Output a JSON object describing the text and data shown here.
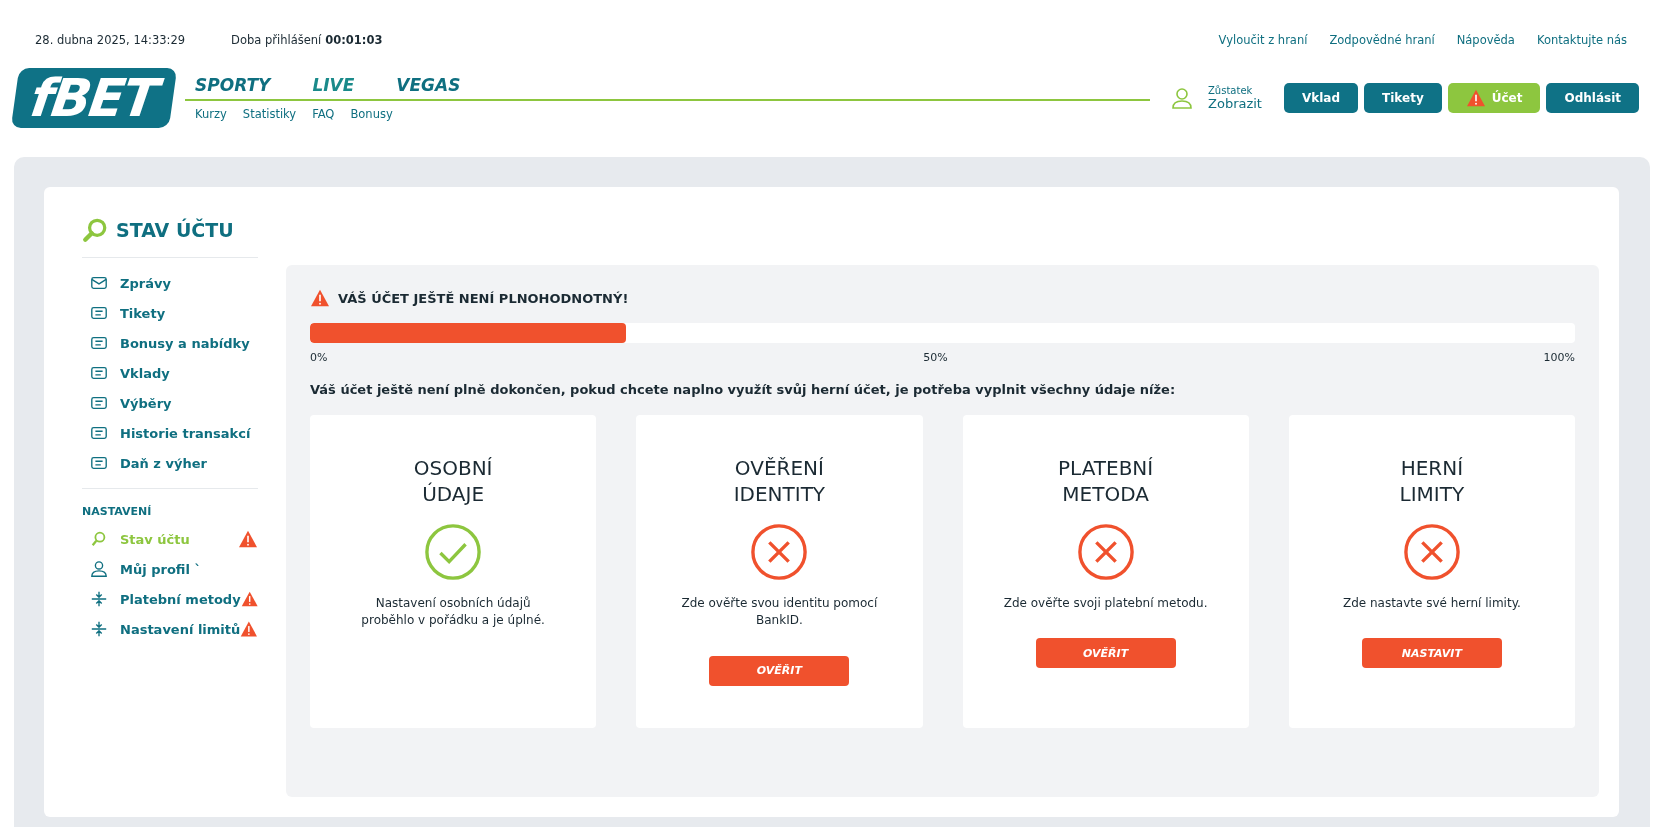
{
  "topbar": {
    "datetime": "28. dubna 2025, 14:33:29",
    "session_label": "Doba přihlášení",
    "session_time": "00:01:03",
    "links": [
      "Vyloučit z hraní",
      "Zodpovědné hraní",
      "Nápověda",
      "Kontaktujte nás"
    ]
  },
  "header": {
    "logo": "fBET",
    "nav": [
      {
        "label": "SPORTY",
        "selected": false
      },
      {
        "label": "LIVE",
        "selected": true
      },
      {
        "label": "VEGAS",
        "selected": false
      }
    ],
    "subnav": [
      "Kurzy",
      "Statistiky",
      "FAQ",
      "Bonusy"
    ],
    "balance_label": "Zůstatek",
    "balance_value": "Zobrazit",
    "buttons": [
      {
        "label": "Vklad",
        "warning": false
      },
      {
        "label": "Tikety",
        "warning": false
      },
      {
        "label": "Účet",
        "warning": true
      },
      {
        "label": "Odhlásit",
        "warning": false
      }
    ]
  },
  "sidebar": {
    "title": "STAV ÚČTU",
    "items": [
      {
        "label": "Zprávy",
        "selected": false,
        "warning": false
      },
      {
        "label": "Tikety",
        "selected": false,
        "warning": false
      },
      {
        "label": "Bonusy a nabídky",
        "selected": false,
        "warning": false
      },
      {
        "label": "Vklady",
        "selected": false,
        "warning": false
      },
      {
        "label": "Výběry",
        "selected": false,
        "warning": false
      },
      {
        "label": "Historie transakcí",
        "selected": false,
        "warning": false
      },
      {
        "label": "Daň z výher",
        "selected": false,
        "warning": false
      }
    ],
    "section_title": "NASTAVENÍ",
    "settings": [
      {
        "label": "Stav účtu",
        "selected": true,
        "warning": true
      },
      {
        "label": "Můj profil `",
        "selected": false,
        "warning": false
      },
      {
        "label": "Platební metody",
        "selected": false,
        "warning": true
      },
      {
        "label": "Nastavení limitů",
        "selected": false,
        "warning": true
      }
    ]
  },
  "status": {
    "heading": "VÁŠ ÚČET JEŠTĚ NENÍ PLNOHODNOTNÝ!",
    "level": 0.25,
    "scale": [
      "0%",
      "50%",
      "100%"
    ],
    "message": "Váš účet ještě není plně dokončen, pokud chcete naplno využít svůj herní účet, je potřeba vyplnit všechny údaje níže:",
    "cards": [
      {
        "title": [
          "OSOBNÍ",
          "ÚDAJE"
        ],
        "done": true,
        "text": "Nastavení osobních údajů proběhlo v pořádku a je úplné."
      },
      {
        "title": [
          "OVĚŘENÍ",
          "IDENTITY"
        ],
        "done": false,
        "text": "Zde ověřte svou identitu pomocí BankID.",
        "button": "OVĚŘIT"
      },
      {
        "title": [
          "PLATEBNÍ",
          "METODA"
        ],
        "done": false,
        "text": "Zde ověřte svoji platební metodu.",
        "button": "OVĚŘIT"
      },
      {
        "title": [
          "HERNÍ",
          "LIMITY"
        ],
        "done": false,
        "text": "Zde nastavte své herní limity.",
        "button": "NASTAVIT"
      }
    ]
  }
}
